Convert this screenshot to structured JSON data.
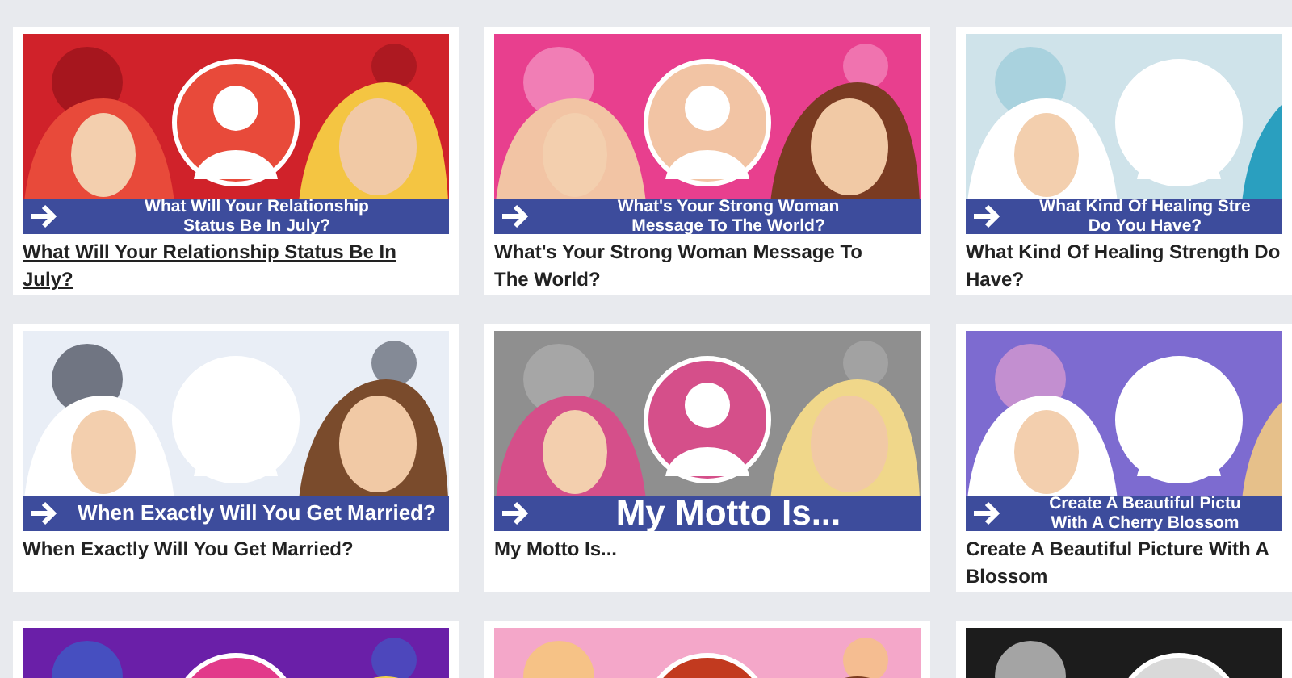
{
  "cards": [
    {
      "kind": "two-line-banner",
      "banner_lines": [
        "What Will Your Relationship",
        "Status Be In July?"
      ],
      "title_lines": [
        "What Will Your Relationship Status Be In",
        "July?"
      ],
      "hovered": true
    },
    {
      "kind": "two-line-banner",
      "banner_lines": [
        "What's Your Strong Woman",
        "Message To The World?"
      ],
      "title_lines": [
        "What's Your Strong Woman Message To",
        "The World?"
      ],
      "hovered": false
    },
    {
      "kind": "two-line-banner",
      "banner_lines": [
        "What Kind Of Healing Stre",
        "Do You Have?"
      ],
      "title_lines": [
        "What Kind Of Healing Strength Do",
        "Have?"
      ],
      "hovered": false
    },
    {
      "kind": "wide-banner",
      "banner_lines": [
        "When Exactly Will You Get Married?"
      ],
      "title_lines": [
        "When Exactly Will You Get Married?"
      ],
      "hovered": false
    },
    {
      "kind": "big-banner",
      "banner_lines": [
        "My Motto Is..."
      ],
      "title_lines": [
        "My Motto Is..."
      ],
      "hovered": false
    },
    {
      "kind": "two-line-banner",
      "banner_lines": [
        "Create A Beautiful Pictu",
        "With A Cherry Blossom"
      ],
      "title_lines": [
        "Create A Beautiful Picture With A",
        "Blossom"
      ],
      "hovered": false
    },
    {
      "kind": "picture"
    },
    {
      "kind": "picture"
    },
    {
      "kind": "picture"
    }
  ]
}
